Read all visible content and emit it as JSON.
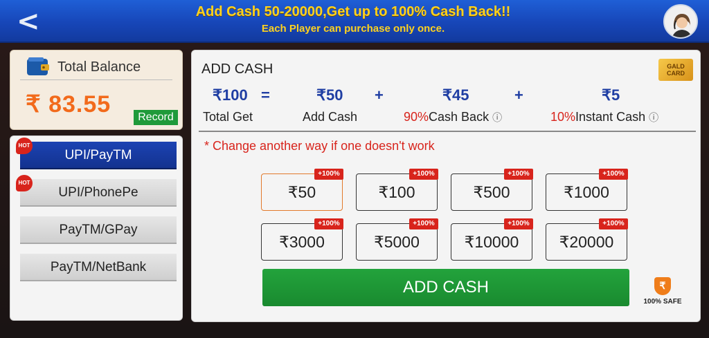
{
  "header": {
    "back_glyph": "<",
    "promo_title": "Add Cash 50-20000,Get up to 100% Cash Back!!",
    "promo_subtitle": "Each Player can purchase only once.",
    "avatar_icon": "user-avatar-icon"
  },
  "balance": {
    "label": "Total Balance",
    "amount": "₹ 83.55",
    "record_label": "Record"
  },
  "methods": [
    {
      "label": "UPI/PayTM",
      "hot": true,
      "active": true
    },
    {
      "label": "UPI/PhonePe",
      "hot": true,
      "active": false
    },
    {
      "label": "PayTM/GPay",
      "hot": false,
      "active": false
    },
    {
      "label": "PayTM/NetBank",
      "hot": false,
      "active": false
    }
  ],
  "hot_label": "HOT",
  "main": {
    "title": "ADD CASH",
    "gold_card_label": "GALD CARD",
    "calc": {
      "total": "₹100",
      "equals": "=",
      "add": "₹50",
      "plus1": "+",
      "cashback": "₹45",
      "plus2": "+",
      "instant": "₹5",
      "total_label": "Total Get",
      "add_label": "Add Cash",
      "cashback_pct": "90%",
      "cashback_label": "Cash Back",
      "instant_pct": "10%",
      "instant_label": "Instant Cash",
      "info_glyph": "ⓘ"
    },
    "note": "* Change another way if one doesn't work",
    "bonus_tag": "+100%",
    "amounts": [
      "₹50",
      "₹100",
      "₹500",
      "₹1000",
      "₹3000",
      "₹5000",
      "₹10000",
      "₹20000"
    ],
    "selected_amount": "₹50",
    "add_cash_button": "ADD CASH",
    "safe_label": "100% SAFE"
  },
  "colors": {
    "header_blue": "#1746b8",
    "promo_yellow": "#ffd21e",
    "balance_orange": "#f26a1b",
    "accent_red": "#d8241c",
    "button_green": "#198a2f",
    "link_blue": "#1f3ea3"
  }
}
